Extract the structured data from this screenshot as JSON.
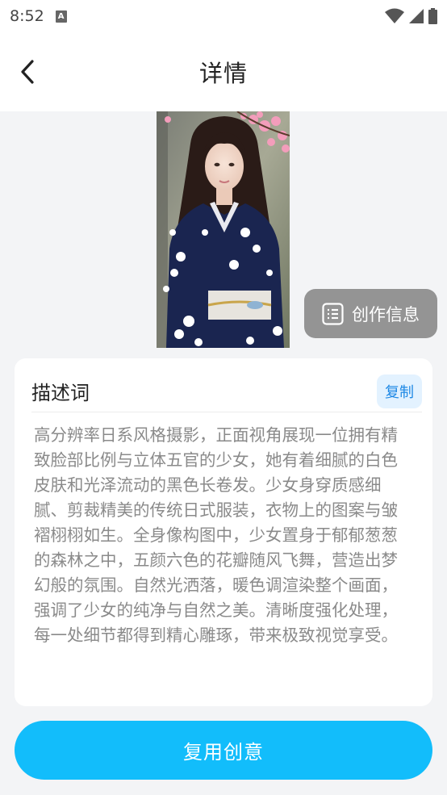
{
  "status_bar": {
    "time": "8:52",
    "notification_icon": "font-a-icon"
  },
  "app_bar": {
    "title": "详情",
    "back_icon": "chevron-left-icon"
  },
  "image": {
    "subject": "woman in navy floral kimono under cherry blossoms"
  },
  "creation_info": {
    "label": "创作信息",
    "icon": "list-document-icon"
  },
  "description": {
    "title": "描述词",
    "copy_label": "复制",
    "text": "高分辨率日系风格摄影，正面视角展现一位拥有精致脸部比例与立体五官的少女，她有着细腻的白色皮肤和光泽流动的黑色长卷发。少女身穿质感细腻、剪裁精美的传统日式服装，衣物上的图案与皱褶栩栩如生。全身像构图中，少女置身于郁郁葱葱的森林之中，五颜六色的花瓣随风飞舞，营造出梦幻般的氛围。自然光洒落，暖色调渲染整个画面，强调了少女的纯净与自然之美。清晰度强化处理，每一处细节都得到精心雕琢，带来极致视觉享受。"
  },
  "reuse_button": {
    "label": "复用创意"
  },
  "colors": {
    "accent": "#12bdfb",
    "copy_bg": "#e3f2ff",
    "copy_text": "#1e88e5",
    "kimono": "#1a2550"
  }
}
